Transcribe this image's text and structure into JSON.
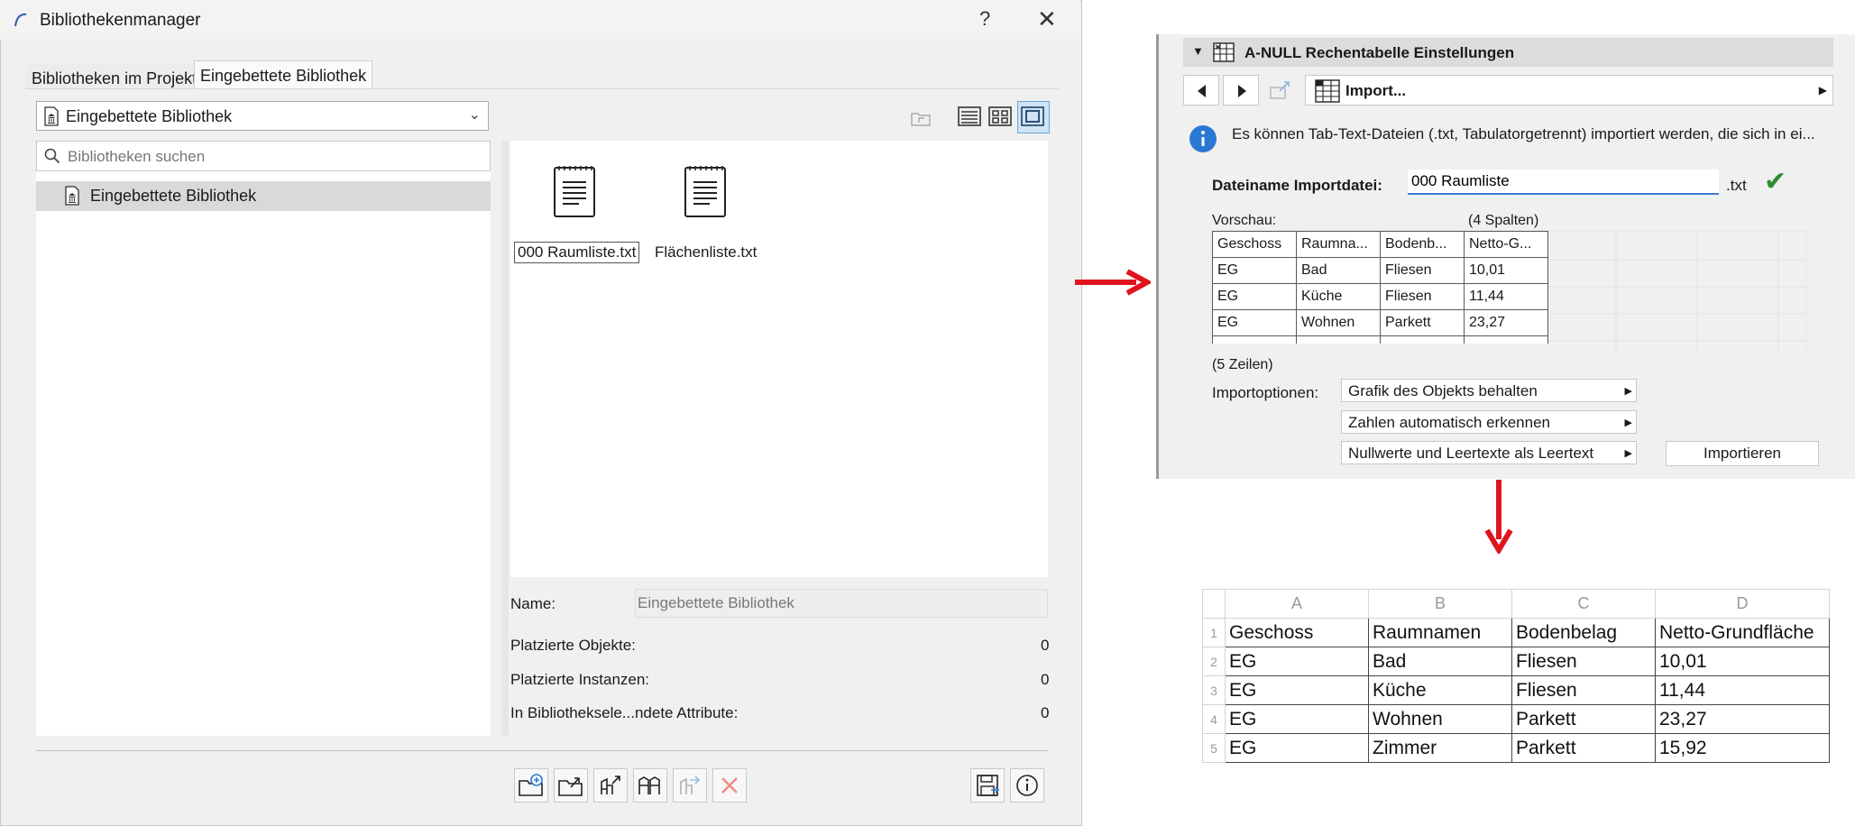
{
  "library_manager": {
    "window_title": "Bibliothekenmanager",
    "help_label": "?",
    "close_label": "✕",
    "tabs": [
      {
        "label": "Bibliotheken im Projekt",
        "active": false
      },
      {
        "label": "Eingebettete Bibliothek",
        "active": true
      }
    ],
    "library_select": {
      "value": "Eingebettete Bibliothek",
      "icon": "library-icon"
    },
    "search": {
      "placeholder": "Bibliotheken suchen",
      "icon": "search-icon"
    },
    "tree": [
      {
        "label": "Eingebettete Bibliothek",
        "icon": "library-icon",
        "selected": true
      }
    ],
    "view_buttons": [
      "list-view-icon",
      "grid-view-icon",
      "large-icon-view-icon"
    ],
    "files": [
      {
        "name": "000 Raumliste.txt",
        "icon": "text-file-icon",
        "editing": true
      },
      {
        "name": "Flächenliste.txt",
        "icon": "text-file-icon",
        "editing": false
      }
    ],
    "properties": {
      "name_label": "Name:",
      "name_value": "Eingebettete Bibliothek",
      "placed_objects_label": "Platzierte Objekte:",
      "placed_objects_value": "0",
      "placed_instances_label": "Platzierte Instanzen:",
      "placed_instances_value": "0",
      "attributes_label": "In Bibliotheksele...ndete Attribute:",
      "attributes_value": "0"
    },
    "toolbar_icons": [
      "add-folder-icon",
      "open-folder-icon",
      "export-objects-icon",
      "objects-icon",
      "move-objects-icon",
      "delete-icon",
      "save-icon",
      "info-icon"
    ],
    "colors": {
      "window_bg": "#f0f0f0",
      "selection": "#d9d9d9",
      "active_view": "#cfe3f5",
      "delete_red": "#e0453a"
    }
  },
  "arrows_color": "#e0141e",
  "anull_panel": {
    "header": "A-NULL Rechentabelle Einstellungen",
    "import_label": "Import...",
    "info_text": "Es können Tab-Text-Dateien (.txt, Tabulatorgetrennt) importiert werden, die sich in ei...",
    "filename_label": "Dateiname Importdatei:",
    "filename_value": "000 Raumliste",
    "filename_ext": ".txt",
    "check_mark": "✔",
    "preview_label": "Vorschau:",
    "preview_columns": "(4 Spalten)",
    "preview_rows": [
      [
        "Geschoss",
        "Raumna...",
        "Bodenb...",
        "Netto-G..."
      ],
      [
        "EG",
        "Bad",
        "Fliesen",
        "10,01"
      ],
      [
        "EG",
        "Küche",
        "Fliesen",
        "11,44"
      ],
      [
        "EG",
        "Wohnen",
        "Parkett",
        "23,27"
      ]
    ],
    "row_count": "(5 Zeilen)",
    "options_label": "Importoptionen:",
    "options": [
      "Grafik des Objekts behalten",
      "Zahlen automatisch erkennen",
      "Nullwerte und Leertexte als Leertext"
    ],
    "import_button": "Importieren",
    "info_color": "#2b78d4",
    "check_color": "#2e8b2e"
  },
  "spreadsheet": {
    "column_letters": [
      "A",
      "B",
      "C",
      "D"
    ],
    "rows": [
      {
        "n": "1",
        "cells": [
          "Geschoss",
          "Raumnamen",
          "Bodenbelag",
          "Netto-Grundfläche"
        ]
      },
      {
        "n": "2",
        "cells": [
          "EG",
          "Bad",
          "Fliesen",
          "10,01"
        ]
      },
      {
        "n": "3",
        "cells": [
          "EG",
          "Küche",
          "Fliesen",
          "11,44"
        ]
      },
      {
        "n": "4",
        "cells": [
          "EG",
          "Wohnen",
          "Parkett",
          "23,27"
        ]
      },
      {
        "n": "5",
        "cells": [
          "EG",
          "Zimmer",
          "Parkett",
          "15,92"
        ]
      }
    ]
  }
}
